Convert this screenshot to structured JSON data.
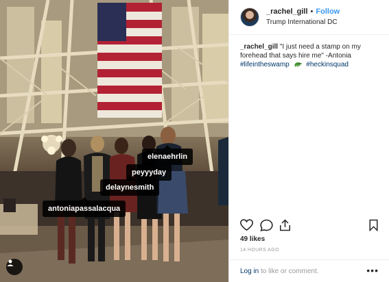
{
  "post": {
    "username": "_rachel_gill",
    "follow_label": "Follow",
    "location": "Trump International DC",
    "caption_username": "_rachel_gill",
    "caption_text": "\"I just need a stamp on my forehead that says hire me\" -Antonia",
    "hashtag_1": "#lifeintheswamp",
    "hashtag_2": "#heckinsquad",
    "likes": "49 likes",
    "timestamp": "14 HOURS AGO"
  },
  "tags": {
    "elena": "elenaehrlin",
    "peyy": "peyyyday",
    "dela": "delaynesmith",
    "anto": "antoniapassalacqua"
  },
  "footer": {
    "login_link": "Log in",
    "login_text": " to like or comment.",
    "more_label": "•••"
  }
}
